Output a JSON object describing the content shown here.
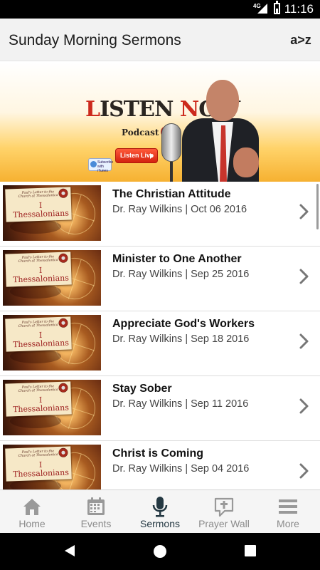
{
  "status_bar": {
    "network": "4G",
    "time": "11:16"
  },
  "header": {
    "title": "Sunday Morning Sermons",
    "sort_label": "a>z"
  },
  "banner": {
    "headline_part1": "L",
    "headline_part2": "ISTEN ",
    "headline_part3": "N",
    "headline_part4": "OW",
    "podcast_label": "Podcast",
    "subscribe_label": "Subscribe with iTunes",
    "listen_live_label": "Listen Live"
  },
  "thumbnail": {
    "small_text": "Paul's Letter to the Church at Thessalonica",
    "book_title": "I Thessalonians"
  },
  "sermons": [
    {
      "title": "The Christian Attitude",
      "meta": "Dr. Ray Wilkins | Oct 06 2016"
    },
    {
      "title": "Minister to One Another",
      "meta": "Dr. Ray Wilkins | Sep 25 2016"
    },
    {
      "title": "Appreciate God's Workers",
      "meta": "Dr. Ray Wilkins | Sep 18 2016"
    },
    {
      "title": "Stay Sober",
      "meta": "Dr. Ray Wilkins | Sep 11 2016"
    },
    {
      "title": "Christ is Coming",
      "meta": "Dr. Ray Wilkins | Sep 04 2016"
    }
  ],
  "tabs": [
    {
      "label": "Home",
      "icon": "home-icon",
      "active": false
    },
    {
      "label": "Events",
      "icon": "calendar-icon",
      "active": false
    },
    {
      "label": "Sermons",
      "icon": "microphone-icon",
      "active": true
    },
    {
      "label": "Prayer Wall",
      "icon": "chat-cross-icon",
      "active": false
    },
    {
      "label": "More",
      "icon": "menu-icon",
      "active": false
    }
  ],
  "colors": {
    "active_tab": "#243842",
    "inactive_tab": "#8b8b8b",
    "accent_red": "#cc2a1d"
  }
}
